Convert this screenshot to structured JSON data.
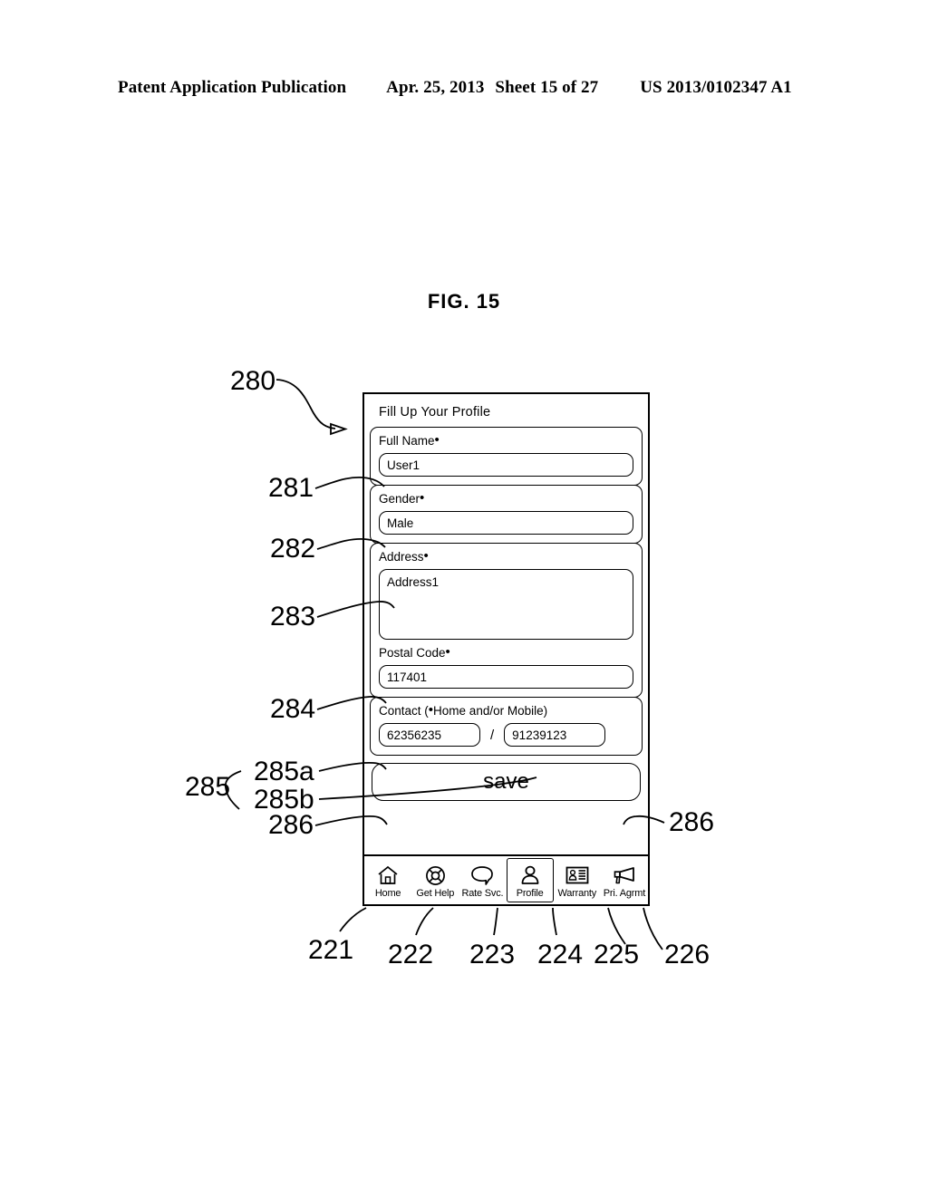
{
  "page_header": {
    "publication": "Patent Application Publication",
    "date": "Apr. 25, 2013",
    "sheet": "Sheet 15 of 27",
    "patent_number": "US 2013/0102347 A1"
  },
  "figure": {
    "caption": "FIG. 15"
  },
  "screen": {
    "title": "Fill Up Your Profile",
    "required_marker": "•",
    "fields": [
      {
        "label": "Full Name",
        "required_marker": "•",
        "value": "User1",
        "type": "text"
      },
      {
        "label": "Gender",
        "required_marker": "•",
        "value": "Male",
        "type": "text"
      },
      {
        "label": "Address",
        "required_marker": "•",
        "value": "Address1",
        "type": "textarea"
      },
      {
        "label": "Postal Code",
        "required_marker": "•",
        "value": "117401",
        "type": "text"
      }
    ],
    "contact": {
      "label_prefix": "Contact (",
      "label_marker": "•",
      "label_suffix": "Home and/or Mobile)",
      "home_value": "62356235",
      "separator": "/",
      "mobile_value": "91239123"
    },
    "save_label": "save"
  },
  "navbar": {
    "items": [
      {
        "label": "Home",
        "icon": "home-icon",
        "selected": false
      },
      {
        "label": "Get Help",
        "icon": "lifebuoy-icon",
        "selected": false
      },
      {
        "label": "Rate Svc.",
        "icon": "speech-bubble-icon",
        "selected": false
      },
      {
        "label": "Profile",
        "icon": "person-icon",
        "selected": true
      },
      {
        "label": "Warranty",
        "icon": "id-card-icon",
        "selected": false
      },
      {
        "label": "Pri. Agrmt",
        "icon": "megaphone-icon",
        "selected": false
      }
    ]
  },
  "reference_numerals": {
    "device": "280",
    "full_name": "281",
    "gender": "282",
    "address": "283",
    "postal_code": "284",
    "contact_group": "285",
    "contact_home": "285a",
    "contact_mobile": "285b",
    "save_left": "286",
    "save_right": "286",
    "nav_home": "221",
    "nav_get_help": "222",
    "nav_rate_svc": "223",
    "nav_profile": "224",
    "nav_warranty": "225",
    "nav_pri_agrmt": "226"
  }
}
